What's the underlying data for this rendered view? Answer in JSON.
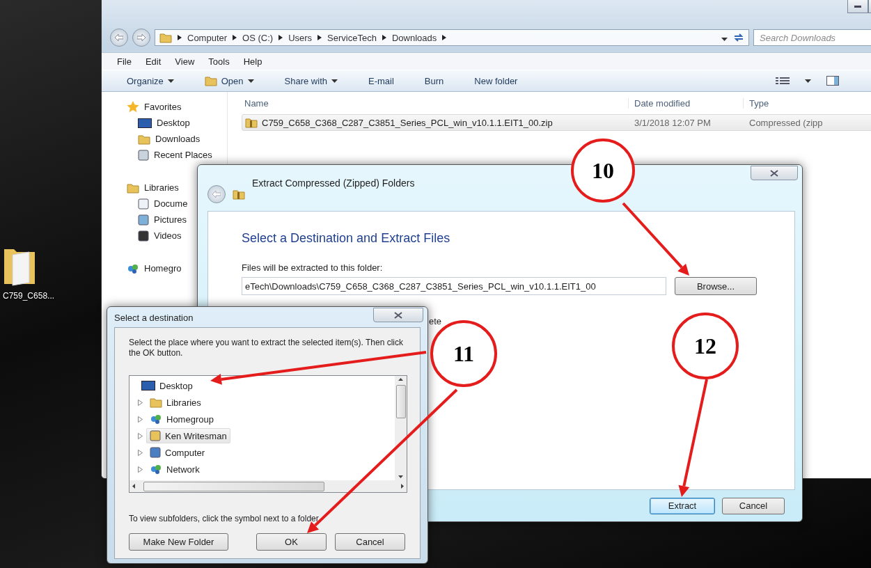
{
  "desktop_icon": {
    "label": "C759_C658..."
  },
  "explorer": {
    "address": [
      "Computer",
      "OS (C:)",
      "Users",
      "ServiceTech",
      "Downloads"
    ],
    "search": {
      "placeholder": "Search Downloads"
    },
    "menu": [
      "File",
      "Edit",
      "View",
      "Tools",
      "Help"
    ],
    "toolbar": [
      {
        "label": "Organize",
        "dropdown": true
      },
      {
        "label": "Open",
        "dropdown": true
      },
      {
        "label": "Share with",
        "dropdown": true
      },
      {
        "label": "E-mail",
        "dropdown": false
      },
      {
        "label": "Burn",
        "dropdown": false
      },
      {
        "label": "New folder",
        "dropdown": false
      }
    ],
    "nav": [
      {
        "label": "Favorites",
        "children": [
          {
            "label": "Desktop"
          },
          {
            "label": "Downloads"
          },
          {
            "label": "Recent Places"
          }
        ]
      },
      {
        "label": "Libraries",
        "children": [
          {
            "label": "Docume"
          },
          {
            "label": "Pictures"
          },
          {
            "label": "Videos"
          }
        ]
      },
      {
        "label": "Homegro"
      }
    ],
    "columns": [
      "Name",
      "Date modified",
      "Type"
    ],
    "rows": [
      {
        "cells": [
          "C759_C658_C368_C287_C3851_Series_PCL_win_v10.1.1.EIT1_00.zip",
          "3/1/2018 12:07 PM",
          "Compressed (zipp"
        ],
        "selected": true
      }
    ]
  },
  "extract_dialog": {
    "title": "Extract Compressed (Zipped) Folders",
    "heading": "Select a Destination and Extract Files",
    "field_label": "Files will be extracted to this folder:",
    "path": "eTech\\Downloads\\C759_C658_C368_C287_C3851_Series_PCL_win_v10.1.1.EIT1_00",
    "browse": "Browse...",
    "checkbox_label": "ete",
    "buttons": [
      {
        "label": "Extract",
        "default": true
      },
      {
        "label": "Cancel",
        "default": false
      }
    ]
  },
  "select_dialog": {
    "title": "Select a destination",
    "instructions": "Select the place where you want to extract the selected item(s).  Then click the OK button.",
    "tree": [
      {
        "label": "Desktop",
        "selected": false,
        "children": [
          {
            "label": "Libraries",
            "expanded": false,
            "selected": false
          },
          {
            "label": "Homegroup",
            "expanded": false,
            "selected": false
          },
          {
            "label": "Ken Writesman",
            "expanded": false,
            "selected": true
          },
          {
            "label": "Computer",
            "expanded": false,
            "selected": false
          },
          {
            "label": "Network",
            "expanded": false,
            "selected": false
          }
        ]
      }
    ],
    "hint": "To view subfolders, click the symbol next to a folder.",
    "buttons": [
      "Make New Folder",
      "OK",
      "Cancel"
    ]
  },
  "annotations": [
    {
      "label": "10"
    },
    {
      "label": "11"
    },
    {
      "label": "12"
    }
  ]
}
